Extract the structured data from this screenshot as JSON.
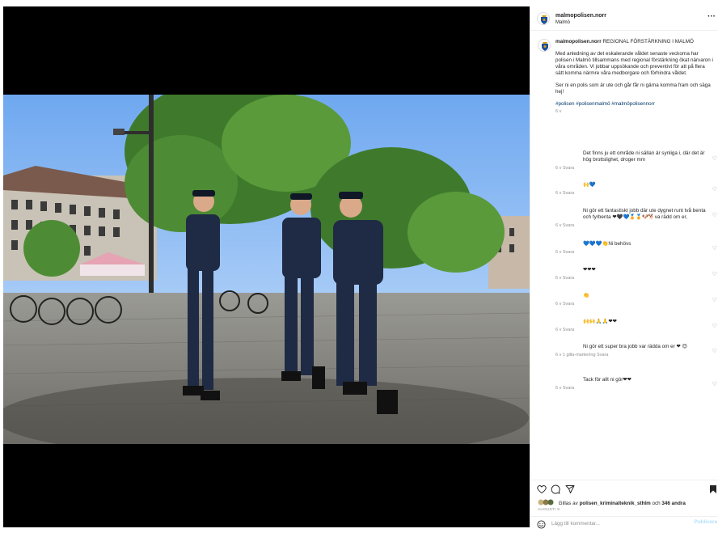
{
  "post": {
    "username": "malmopolisen.norr",
    "location": "Malmö",
    "more": "···"
  },
  "caption": {
    "username": "malmopolisen.norr",
    "title": "REGIONAL FÖRSTÄRKNING I MALMÖ",
    "para1": "Med anledning av det eskalerande våldet senaste veckorna har polisen i Malmö tillsammans med regional förstärkning ökat närvaron i våra områden. Vi jobbar uppsökande och preventivt för att på flera sätt komma närmre våra medborgare och förhindra våldet.",
    "para2": "Ser ni en polis som är ute och går får ni gärna komma fram och säga hej!",
    "hashtags": "#polisen #polisenmalmö #malmöpolisennorr",
    "time": "6 v"
  },
  "comments": [
    {
      "text": "Det finns ju ett område ni sällan är synliga i, där det är hög brottslighet, droger mm",
      "meta": "6 v   Svara"
    },
    {
      "text": "🙌💙",
      "meta": "6 v   Svara"
    },
    {
      "text": "Ni gör ett fantastiskt jobb där ute dygnet runt två benta och fyrbenta ❤🖤💙🏅🏅🐶🐕va rädd om er,",
      "meta": "6 v   Svara"
    },
    {
      "text": "💙💙💙👏Ni behövs",
      "meta": "6 v   Svara"
    },
    {
      "text": "❤❤❤",
      "meta": "6 v   Svara"
    },
    {
      "text": "👏",
      "meta": "6 v   Svara"
    },
    {
      "text": "🙌🙌🙏🙏❤❤",
      "meta": "6 v   Svara"
    },
    {
      "text": "Ni gör ett super bra jobb var rädda om er ❤ 😍",
      "meta": "6 v   1 gilla-markering   Svara"
    },
    {
      "text": "Tack för allt ni gör❤❤",
      "meta": "6 v   Svara"
    }
  ],
  "actions": {
    "liked_by_prefix": "Gillas av",
    "liked_by_user": "polisen_kriminalteknik_sthlm",
    "liked_by_and": "och",
    "liked_by_others": "346 andra",
    "date": "AUGUSTI 9"
  },
  "add_comment": {
    "placeholder": "Lägg till kommentar...",
    "publish": "Publicera"
  },
  "icons": {
    "heart": "heart-icon",
    "comment": "comment-icon",
    "share": "paper-plane-icon",
    "save": "bookmark-icon",
    "emoji": "emoji-icon"
  },
  "colors": {
    "link": "#00376b",
    "muted": "#8e8e8e",
    "publish_disabled": "#b2dffc"
  }
}
